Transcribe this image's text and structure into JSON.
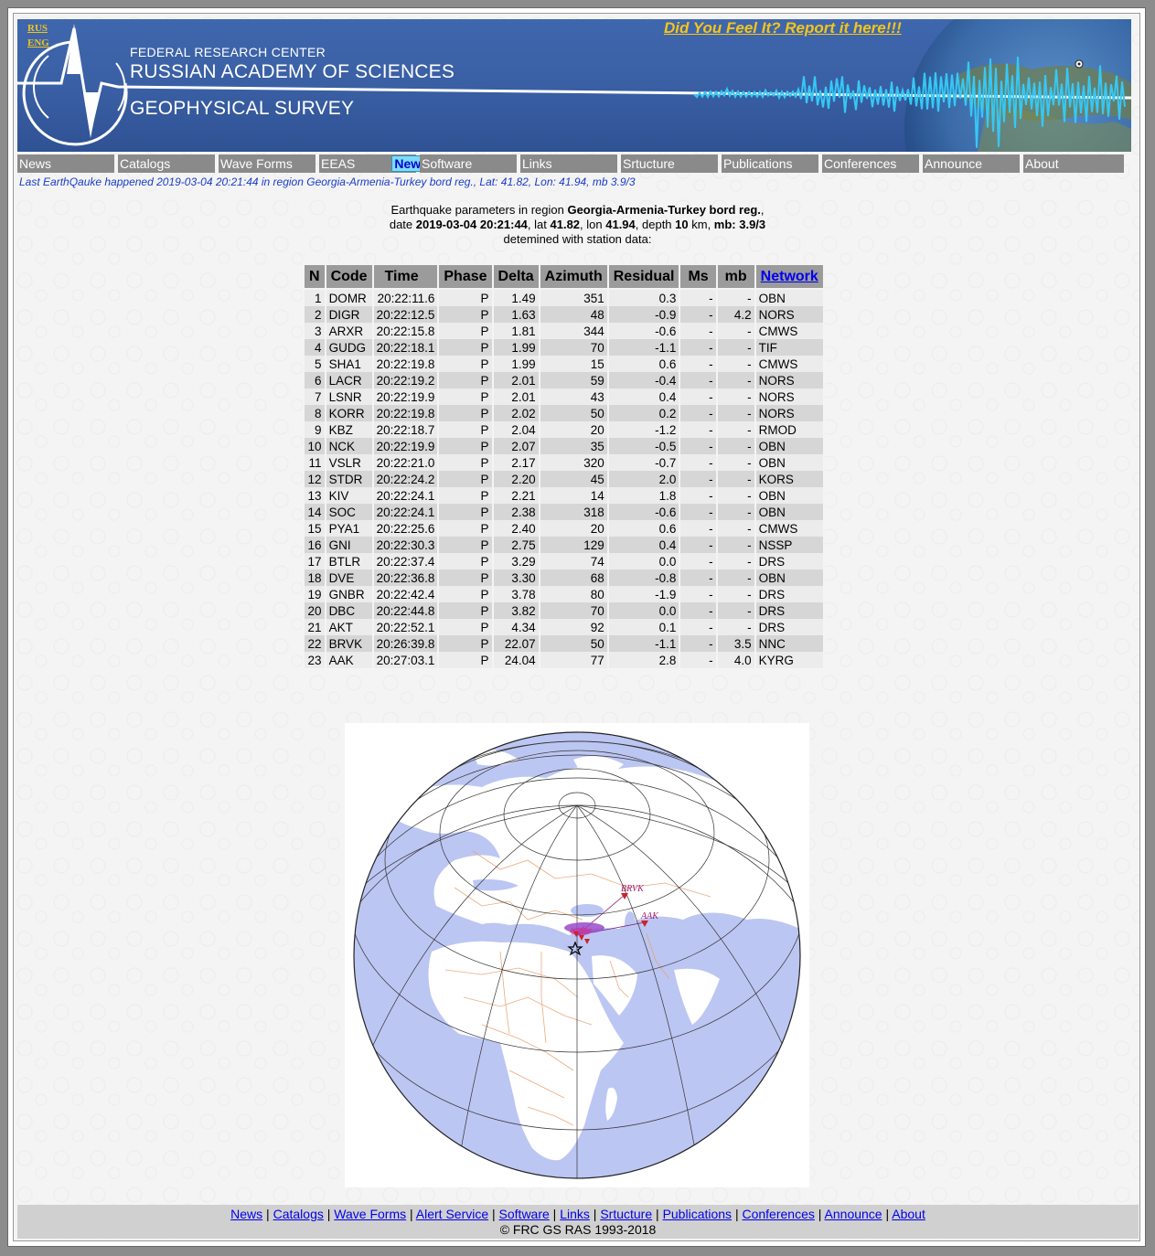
{
  "banner": {
    "lang_rus": "RUS",
    "lang_eng": "ENG",
    "line1": "FEDERAL RESEARCH CENTER",
    "line2": "RUSSIAN ACADEMY OF SCIENCES",
    "line3": "GEOPHYSICAL SURVEY",
    "report_link": "Did You Feel It? Report it here!!!"
  },
  "nav": {
    "items": [
      "News",
      "Catalogs",
      "Wave Forms",
      "EEAS",
      "Software",
      "Links",
      "Srtucture",
      "Publications",
      "Conferences",
      "Announce",
      "About"
    ],
    "new_badge": "New!"
  },
  "last_quake": "Last EarthQauke happened 2019-03-04 20:21:44 in region Georgia-Armenia-Turkey bord reg., Lat: 41.82, Lon: 41.94, mb 3.9/3",
  "params": {
    "intro": "Earthquake parameters in region ",
    "region": "Georgia-Armenia-Turkey bord reg.",
    "date_label": "date ",
    "date": "2019-03-04 20:21:44",
    "lat_label": ", lat ",
    "lat": "41.82",
    "lon_label": ", lon ",
    "lon": "41.94",
    "depth_label": ", depth ",
    "depth": "10",
    "km_label": " km, ",
    "mb_label": "mb: 3.9/3",
    "line3": "detemined with station data:"
  },
  "table": {
    "headers": [
      "N",
      "Code",
      "Time",
      "Phase",
      "Delta",
      "Azimuth",
      "Residual",
      "Ms",
      "mb",
      "Network"
    ],
    "rows": [
      [
        "1",
        "DOMR",
        "20:22:11.6",
        "P",
        "1.49",
        "351",
        "0.3",
        "-",
        "-",
        "OBN"
      ],
      [
        "2",
        "DIGR",
        "20:22:12.5",
        "P",
        "1.63",
        "48",
        "-0.9",
        "-",
        "4.2",
        "NORS"
      ],
      [
        "3",
        "ARXR",
        "20:22:15.8",
        "P",
        "1.81",
        "344",
        "-0.6",
        "-",
        "-",
        "CMWS"
      ],
      [
        "4",
        "GUDG",
        "20:22:18.1",
        "P",
        "1.99",
        "70",
        "-1.1",
        "-",
        "-",
        "TIF"
      ],
      [
        "5",
        "SHA1",
        "20:22:19.8",
        "P",
        "1.99",
        "15",
        "0.6",
        "-",
        "-",
        "CMWS"
      ],
      [
        "6",
        "LACR",
        "20:22:19.2",
        "P",
        "2.01",
        "59",
        "-0.4",
        "-",
        "-",
        "NORS"
      ],
      [
        "7",
        "LSNR",
        "20:22:19.9",
        "P",
        "2.01",
        "43",
        "0.4",
        "-",
        "-",
        "NORS"
      ],
      [
        "8",
        "KORR",
        "20:22:19.8",
        "P",
        "2.02",
        "50",
        "0.2",
        "-",
        "-",
        "NORS"
      ],
      [
        "9",
        "KBZ",
        "20:22:18.7",
        "P",
        "2.04",
        "20",
        "-1.2",
        "-",
        "-",
        "RMOD"
      ],
      [
        "10",
        "NCK",
        "20:22:19.9",
        "P",
        "2.07",
        "35",
        "-0.5",
        "-",
        "-",
        "OBN"
      ],
      [
        "11",
        "VSLR",
        "20:22:21.0",
        "P",
        "2.17",
        "320",
        "-0.7",
        "-",
        "-",
        "OBN"
      ],
      [
        "12",
        "STDR",
        "20:22:24.2",
        "P",
        "2.20",
        "45",
        "2.0",
        "-",
        "-",
        "KORS"
      ],
      [
        "13",
        "KIV",
        "20:22:24.1",
        "P",
        "2.21",
        "14",
        "1.8",
        "-",
        "-",
        "OBN"
      ],
      [
        "14",
        "SOC",
        "20:22:24.1",
        "P",
        "2.38",
        "318",
        "-0.6",
        "-",
        "-",
        "OBN"
      ],
      [
        "15",
        "PYA1",
        "20:22:25.6",
        "P",
        "2.40",
        "20",
        "0.6",
        "-",
        "-",
        "CMWS"
      ],
      [
        "16",
        "GNI",
        "20:22:30.3",
        "P",
        "2.75",
        "129",
        "0.4",
        "-",
        "-",
        "NSSP"
      ],
      [
        "17",
        "BTLR",
        "20:22:37.4",
        "P",
        "3.29",
        "74",
        "0.0",
        "-",
        "-",
        "DRS"
      ],
      [
        "18",
        "DVE",
        "20:22:36.8",
        "P",
        "3.30",
        "68",
        "-0.8",
        "-",
        "-",
        "OBN"
      ],
      [
        "19",
        "GNBR",
        "20:22:42.4",
        "P",
        "3.78",
        "80",
        "-1.9",
        "-",
        "-",
        "DRS"
      ],
      [
        "20",
        "DBC",
        "20:22:44.8",
        "P",
        "3.82",
        "70",
        "0.0",
        "-",
        "-",
        "DRS"
      ],
      [
        "21",
        "AKT",
        "20:22:52.1",
        "P",
        "4.34",
        "92",
        "0.1",
        "-",
        "-",
        "DRS"
      ],
      [
        "22",
        "BRVK",
        "20:26:39.8",
        "P",
        "22.07",
        "50",
        "-1.1",
        "-",
        "3.5",
        "NNC"
      ],
      [
        "23",
        "AAK",
        "20:27:03.1",
        "P",
        "24.04",
        "77",
        "2.8",
        "-",
        "4.0",
        "KYRG"
      ]
    ]
  },
  "map": {
    "labels": [
      "BRVK",
      "AAK"
    ],
    "colors": {
      "ocean": "#bcc6f2",
      "land": "#ffffff",
      "borders": "#e8a070",
      "grid": "#333333",
      "station": "#d0202a",
      "ray": "#7a1a6a"
    }
  },
  "footer": {
    "links": [
      "News",
      "Catalogs",
      "Wave Forms",
      "Alert Service",
      "Software",
      "Links",
      "Srtucture",
      "Publications",
      "Conferences",
      "Announce",
      "About"
    ],
    "copyright": "© FRC GS RAS 1993-2018"
  },
  "colors": {
    "banner": "#3a5fa4",
    "nav": "#8a8a8a",
    "accent": "#f5c518",
    "link": "#0000ee"
  }
}
